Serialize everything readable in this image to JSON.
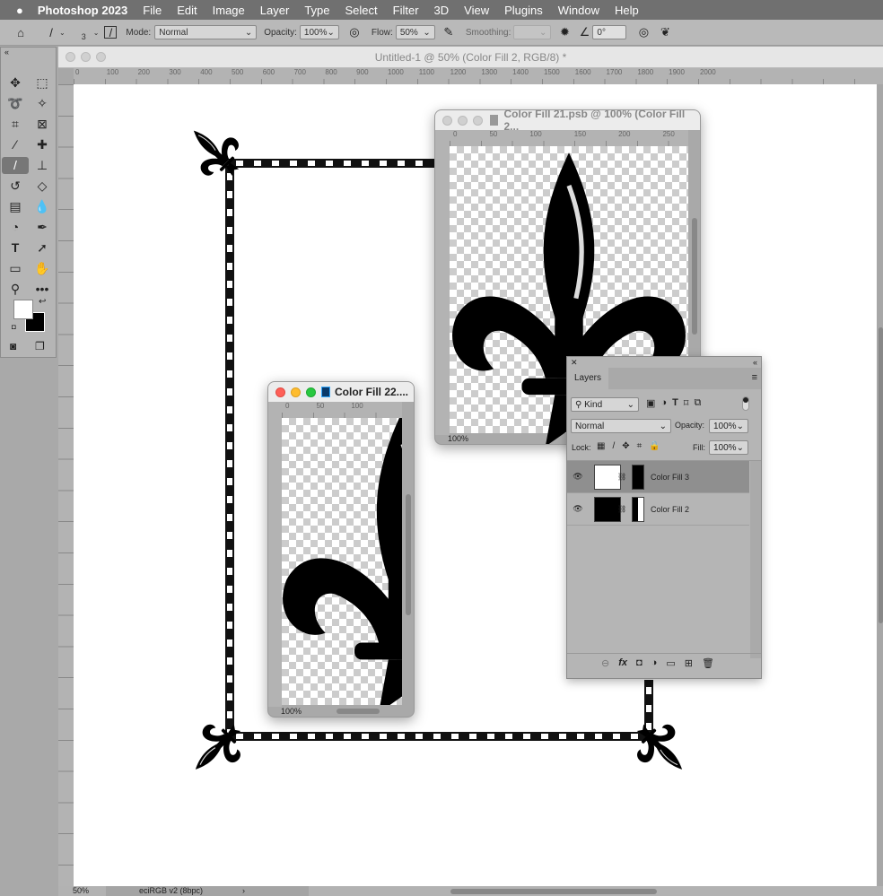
{
  "menubar": {
    "apple": "",
    "app": "Photoshop 2023",
    "items": [
      "File",
      "Edit",
      "Image",
      "Layer",
      "Type",
      "Select",
      "Filter",
      "3D",
      "View",
      "Plugins",
      "Window",
      "Help"
    ]
  },
  "options": {
    "brush_size": "3",
    "mode_label": "Mode:",
    "mode_value": "Normal",
    "opacity_label": "Opacity:",
    "opacity_value": "100%",
    "flow_label": "Flow:",
    "flow_value": "50%",
    "smoothing_label": "Smoothing:",
    "smoothing_value": "",
    "angle_value": "0°"
  },
  "document": {
    "title": "Untitled-1 @ 50% (Color Fill 2, RGB/8) *",
    "ruler_ticks": [
      "0",
      "100",
      "200",
      "300",
      "400",
      "500",
      "600",
      "700",
      "800",
      "900",
      "1000",
      "1100",
      "1200",
      "1300",
      "1400",
      "1500",
      "1600",
      "1700",
      "1800",
      "1900",
      "2000"
    ],
    "zoom": "50%",
    "profile": "eciRGB v2 (8bpc)",
    "arrow": "›"
  },
  "window21": {
    "title": "Color Fill 21.psb @ 100% (Color Fill 2...",
    "ruler_ticks": [
      "0",
      "50",
      "100",
      "150",
      "200",
      "250"
    ],
    "zoom": "100%"
  },
  "window22": {
    "title": "Color Fill 22....",
    "ruler_ticks": [
      "0",
      "50",
      "100"
    ],
    "zoom": "100%"
  },
  "layers": {
    "tab": "Layers",
    "filter": "Kind",
    "blend": "Normal",
    "opacity_label": "Opacity:",
    "opacity": "100%",
    "lock_label": "Lock:",
    "fill_label": "Fill:",
    "fill": "100%",
    "items": [
      {
        "name": "Color Fill 3",
        "color": "#ffffff",
        "selected": true
      },
      {
        "name": "Color Fill 2",
        "color": "#000000",
        "selected": false
      }
    ]
  },
  "colors": {
    "foreground": "#ffffff",
    "background": "#000000",
    "accent_red": "#fe5f57",
    "accent_yellow": "#febc2e",
    "accent_green": "#28c840"
  }
}
